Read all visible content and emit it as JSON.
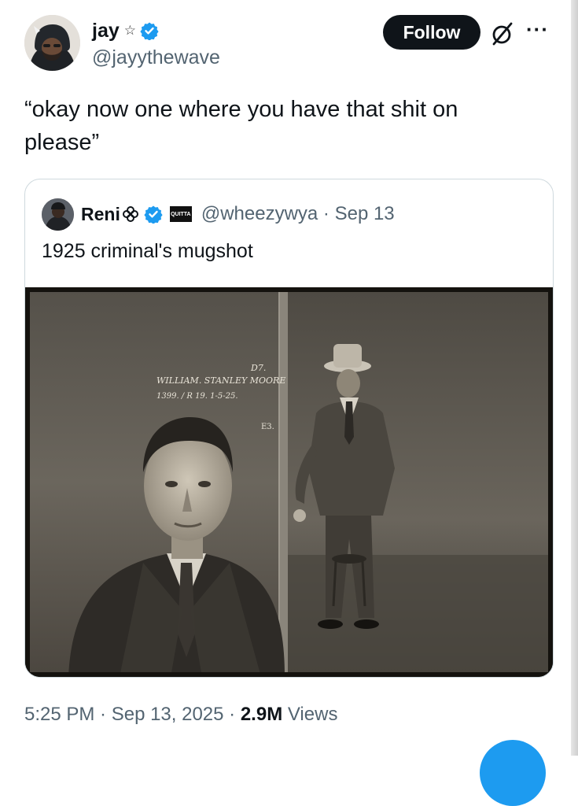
{
  "author": {
    "display_name": "jay",
    "name_emoji": "☆",
    "handle": "@jayythewave"
  },
  "header": {
    "follow_label": "Follow",
    "grok_icon": "grok-icon",
    "more_label": "···"
  },
  "tweet": {
    "text": "“okay now one where you have that shit on please”"
  },
  "quoted": {
    "display_name": "Reni",
    "badge_text": "QUITTA",
    "meta": "@wheezywya · Sep 13",
    "text": "1925 criminal's mugshot",
    "image_caption_line1": "WILLIAM. STANLEY MOORE",
    "image_caption_line2": "1399. / R 19. 1-5-25.",
    "image_mark_top": "D7.",
    "image_mark_e": "E3."
  },
  "footer": {
    "time_date": "5:25 PM · Sep 13, 2025 · ",
    "views_count": "2.9M",
    "views_label": " Views"
  },
  "colors": {
    "verified_blue": "#1d9bf0",
    "text_primary": "#0f1419",
    "text_secondary": "#536471",
    "border": "#cfd9de"
  }
}
